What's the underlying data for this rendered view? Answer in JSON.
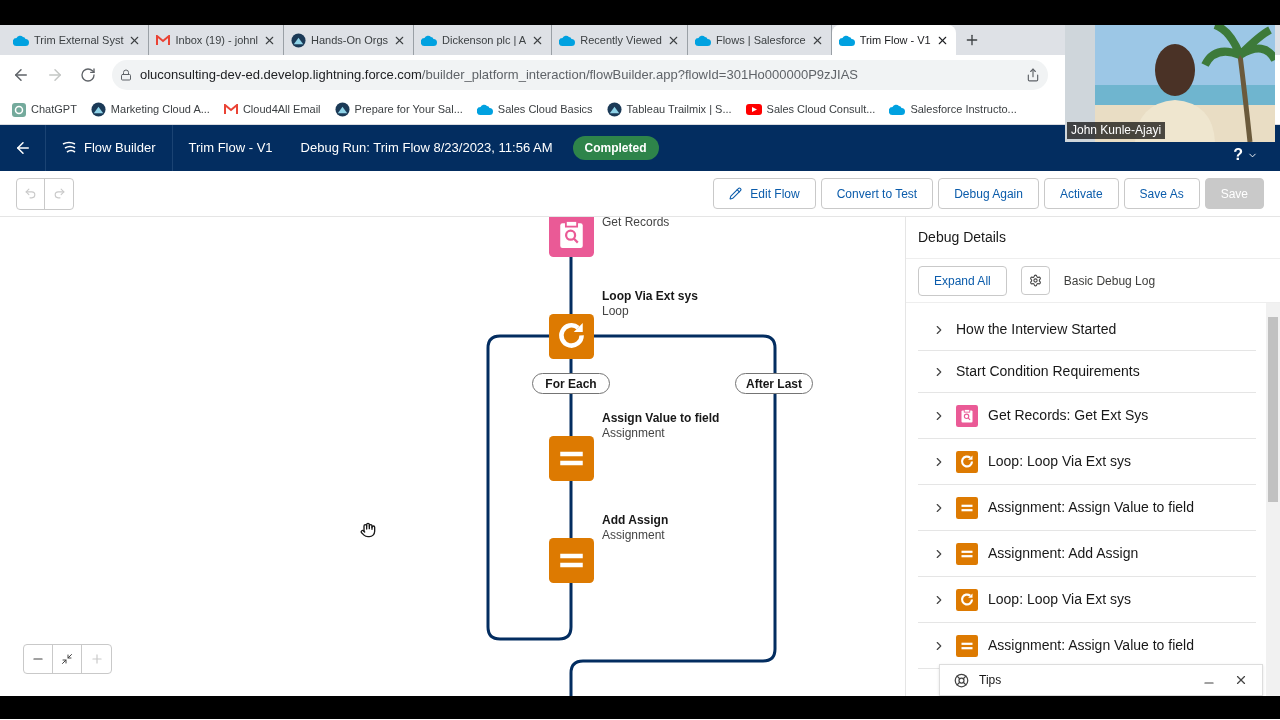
{
  "browser": {
    "tabs": [
      {
        "title": "Trim External Syst",
        "kind": "cloud",
        "selected": false
      },
      {
        "title": "Inbox (19) - johnl",
        "kind": "mail",
        "selected": false
      },
      {
        "title": "Hands-On Orgs",
        "kind": "mountain",
        "selected": false
      },
      {
        "title": "Dickenson plc | A",
        "kind": "cloud",
        "selected": false
      },
      {
        "title": "Recently Viewed",
        "kind": "cloud",
        "selected": false
      },
      {
        "title": "Flows | Salesforce",
        "kind": "cloud",
        "selected": false
      },
      {
        "title": "Trim Flow - V1",
        "kind": "cloud",
        "selected": true
      }
    ],
    "forward_disabled": true,
    "address": {
      "host": "oluconsulting-dev-ed.develop.lightning.force.com",
      "path": "/builder_platform_interaction/flowBuilder.app?flowId=301Ho000000P9zJIAS"
    },
    "bookmarks": [
      {
        "label": "ChatGPT",
        "kind": "chatgpt"
      },
      {
        "label": "Marketing Cloud A...",
        "kind": "mountain"
      },
      {
        "label": "Cloud4All Email",
        "kind": "mail"
      },
      {
        "label": "Prepare for Your Sal...",
        "kind": "mountain"
      },
      {
        "label": "Sales Cloud Basics",
        "kind": "cloud"
      },
      {
        "label": "Tableau Trailmix | S...",
        "kind": "mountain"
      },
      {
        "label": "Sales Cloud Consult...",
        "kind": "youtube"
      },
      {
        "label": "Salesforce Instructo...",
        "kind": "cloud"
      }
    ]
  },
  "header": {
    "app": "Flow Builder",
    "flow": "Trim Flow - V1",
    "debug_run": "Debug Run: Trim Flow 8/23/2023, 11:56 AM",
    "status": "Completed",
    "help": "?"
  },
  "toolbar": {
    "undo_disabled": true,
    "redo_disabled": true,
    "buttons": [
      {
        "label": "Edit Flow",
        "kind": "edit",
        "disabled": false
      },
      {
        "label": "Convert to Test",
        "kind": "plain",
        "disabled": false
      },
      {
        "label": "Debug Again",
        "kind": "plain",
        "disabled": false
      },
      {
        "label": "Activate",
        "kind": "plain",
        "disabled": false
      },
      {
        "label": "Save As",
        "kind": "plain",
        "disabled": false
      },
      {
        "label": "Save",
        "kind": "plain",
        "disabled": true
      }
    ]
  },
  "canvas": {
    "nodes": [
      {
        "kind": "records",
        "subtitle": "Get Records"
      },
      {
        "kind": "loop",
        "title": "Loop Via Ext sys",
        "subtitle": "Loop"
      },
      {
        "kind": "assignment",
        "title": "Assign Value to field",
        "subtitle": "Assignment"
      },
      {
        "kind": "assignment",
        "title": "Add Assign",
        "subtitle": "Assignment"
      }
    ],
    "branch_labels": [
      "For Each",
      "After Last"
    ],
    "zoom_in_disabled": true
  },
  "debug_panel": {
    "title": "Debug Details",
    "expand_all": "Expand All",
    "log_level": "Basic Debug Log",
    "items": [
      {
        "kind": "plain",
        "label": "How the Interview Started"
      },
      {
        "kind": "plain",
        "label": "Start Condition Requirements"
      },
      {
        "kind": "records",
        "label": "Get Records: Get Ext Sys"
      },
      {
        "kind": "loop",
        "label": "Loop: Loop Via Ext sys"
      },
      {
        "kind": "assignment",
        "label": "Assignment: Assign Value to field"
      },
      {
        "kind": "assignment",
        "label": "Assignment: Add Assign"
      },
      {
        "kind": "loop",
        "label": "Loop: Loop Via Ext sys"
      },
      {
        "kind": "assignment",
        "label": "Assignment: Assign Value to field"
      }
    ],
    "tips": "Tips"
  },
  "webcam": {
    "kind": "picture",
    "name": "John Kunle-Ajayi"
  }
}
